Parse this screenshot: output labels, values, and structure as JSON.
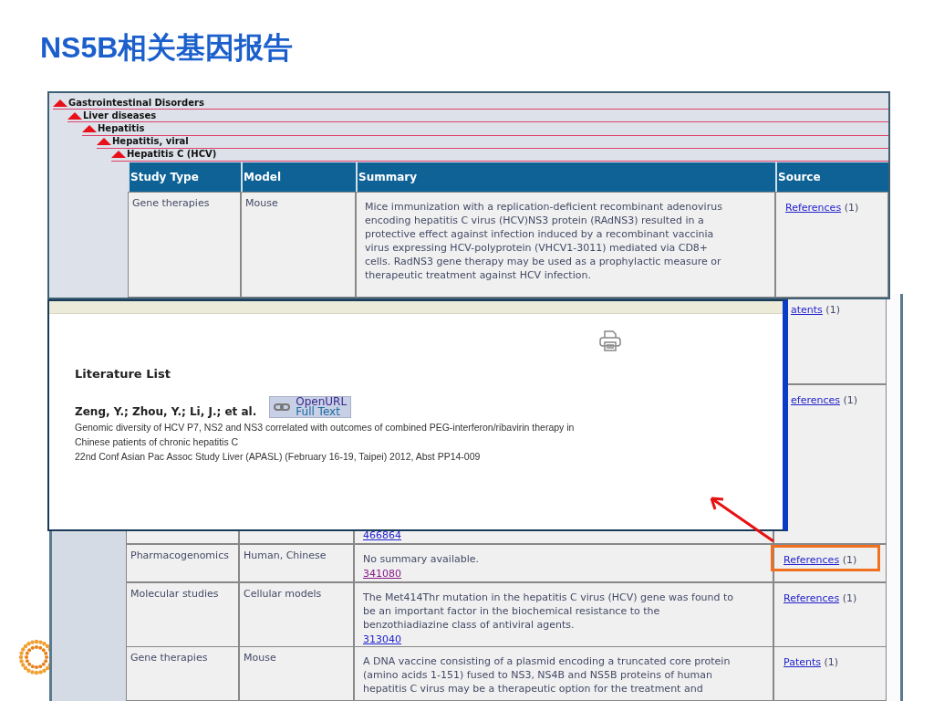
{
  "title": "NS5B相关基因报告",
  "tree": [
    {
      "label": "Gastrointestinal Disorders",
      "expanded": true,
      "children": [
        {
          "label": "Liver diseases",
          "expanded": true,
          "children": [
            {
              "label": "Hepatitis",
              "expanded": true,
              "children": [
                {
                  "label": "Hepatitis, viral",
                  "expanded": true,
                  "children": [
                    {
                      "label": "Hepatitis C (HCV)",
                      "expanded": true
                    }
                  ]
                }
              ]
            }
          ]
        }
      ]
    }
  ],
  "table": {
    "columns": [
      "Study Type",
      "Model",
      "Summary",
      "Source"
    ],
    "rows": [
      {
        "study_type": "Gene therapies",
        "model": "Mouse",
        "summary_lines": [
          "Mice immunization with a replication-deficient recombinant adenovirus",
          "encoding hepatitis C virus (HCV)NS3 protein (RAdNS3) resulted in a",
          "protective effect against infection induced by a recombinant vaccinia",
          "virus expressing HCV-polyprotein (VHCV1-3011) mediated via CD8+",
          "cells. RadNS3 gene therapy may be used as a prophylactic measure or",
          "therapeutic treatment against HCV infection."
        ],
        "source_link": "References",
        "source_count": "(1)",
        "highlighted": false
      }
    ]
  },
  "popup": {
    "heading": "Literature List",
    "authors": "Zeng, Y.; Zhou, Y.; Li, J.; et al.",
    "openurl": [
      "OpenURL",
      "Full Text"
    ],
    "lines": [
      "Genomic diversity of HCV P7, NS2 and NS3 correlated with outcomes of combined PEG-interferon/ribavirin therapy in",
      "Chinese patients of chronic hepatitis C",
      "22nd Conf Asian Pac Assoc Study Liver (APASL) (February 16-19, Taipei) 2012, Abst PP14-009"
    ]
  },
  "background_table": {
    "rows": [
      {
        "source_link": "atents",
        "source_count": "(1)",
        "highlighted": false
      },
      {
        "summary_link": "466864",
        "link_visited": false,
        "source_link": "eferences",
        "source_count": "(1)",
        "highlighted": false
      },
      {
        "study_type": "Pharmacogenomics",
        "model": "Human, Chinese",
        "summary_lines": [
          "No summary available."
        ],
        "summary_link": "341080",
        "link_visited": true,
        "source_link": "References",
        "source_count": "(1)",
        "highlighted": true
      },
      {
        "study_type": "Molecular studies",
        "model": "Cellular models",
        "summary_lines": [
          "The Met414Thr mutation in the hepatitis C virus (HCV) gene was found to",
          "be an important factor in the biochemical resistance to the",
          "benzothiadiazine class of antiviral agents."
        ],
        "summary_link": "313040",
        "link_visited": false,
        "source_link": "References",
        "source_count": "(1)",
        "highlighted": false
      },
      {
        "study_type": "Gene therapies",
        "model": "Mouse",
        "summary_lines": [
          "A DNA vaccine consisting of a plasmid encoding a truncated core protein",
          "(amino acids 1-151) fused to NS3, NS4B and NS5B proteins of human",
          "hepatitis C virus may be a therapeutic option for the treatment and"
        ],
        "source_link": "Patents",
        "source_count": "(1)",
        "highlighted": false
      }
    ]
  }
}
